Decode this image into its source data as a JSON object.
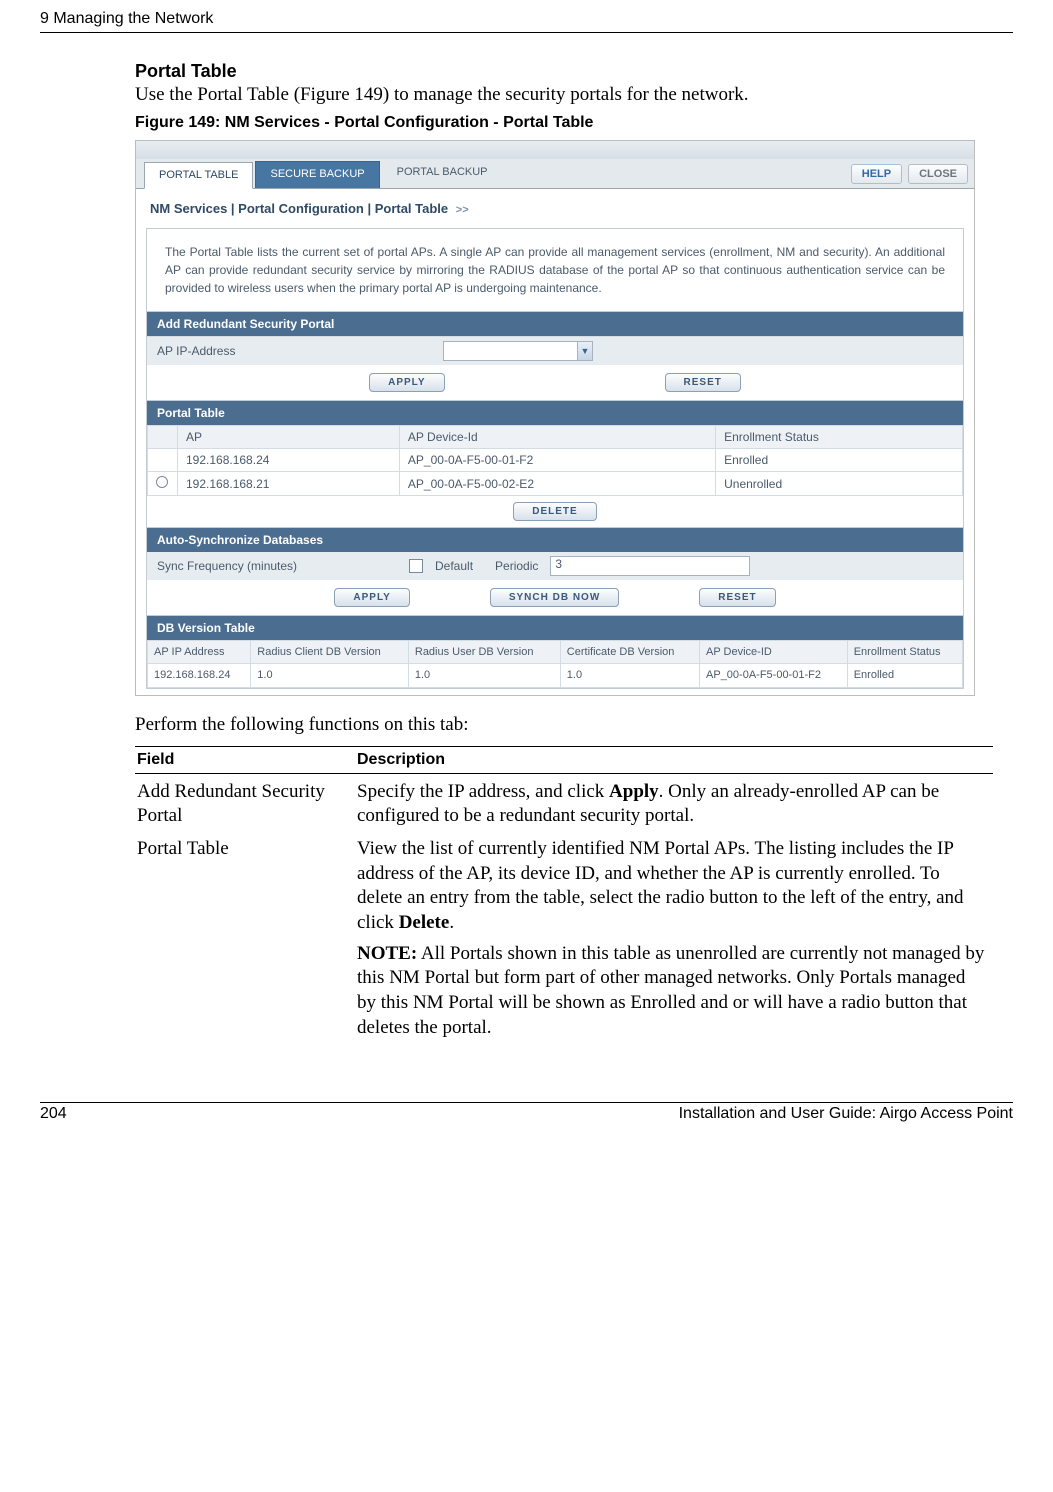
{
  "running_head": {
    "left": "9  Managing the Network",
    "right": ""
  },
  "section": {
    "subhead": "Portal Table",
    "intro": "Use the Portal Table (Figure 149) to manage the security portals for the network.",
    "figure_caption": "Figure 149:    NM Services - Portal Configuration - Portal Table"
  },
  "screenshot": {
    "tabs": {
      "portal_table": "PORTAL TABLE",
      "secure_backup": "SECURE BACKUP",
      "portal_backup": "PORTAL BACKUP"
    },
    "buttons": {
      "help": "HELP",
      "close": "CLOSE",
      "apply": "APPLY",
      "reset": "RESET",
      "delete": "DELETE",
      "synch": "SYNCH DB NOW"
    },
    "breadcrumb": "NM Services | Portal Configuration | Portal Table",
    "intro_text": "The Portal Table lists the current set of portal APs. A single AP can provide all management services (enrollment, NM and security). An additional AP can provide redundant security service by mirroring the RADIUS database of the portal AP so that continuous authentication service can be provided to wireless users when the primary portal AP is undergoing maintenance.",
    "add_portal": {
      "header": "Add Redundant Security Portal",
      "label": "AP IP-Address"
    },
    "portal_table": {
      "header": "Portal Table",
      "cols": {
        "ap": "AP",
        "device": "AP Device-Id",
        "status": "Enrollment Status"
      },
      "rows": [
        {
          "selectable": false,
          "ap": "192.168.168.24",
          "device": "AP_00-0A-F5-00-01-F2",
          "status": "Enrolled"
        },
        {
          "selectable": true,
          "ap": "192.168.168.21",
          "device": "AP_00-0A-F5-00-02-E2",
          "status": "Unenrolled"
        }
      ]
    },
    "sync": {
      "header": "Auto-Synchronize Databases",
      "label": "Sync Frequency (minutes)",
      "default": "Default",
      "periodic": "Periodic",
      "value": "3"
    },
    "db_table": {
      "header": "DB Version Table",
      "cols": {
        "ip": "AP\nIP Address",
        "rclient": "Radius\nClient\nDB Version",
        "ruser": "Radius\nUser\nDB Version",
        "cert": "Certificate\nDB Version",
        "device": "AP Device-ID",
        "status": "Enrollment\nStatus"
      },
      "rows": [
        {
          "ip": "192.168.168.24",
          "rclient": "1.0",
          "ruser": "1.0",
          "cert": "1.0",
          "device": "AP_00-0A-F5-00-01-F2",
          "status": "Enrolled"
        }
      ]
    }
  },
  "after_text": "Perform the following functions on this tab:",
  "table": {
    "head_field": "Field",
    "head_desc": "Description",
    "rows": [
      {
        "field": "Add Redundant Security Portal",
        "desc_before": "Specify the IP address, and click ",
        "desc_bold": "Apply",
        "desc_after": ". Only an already-enrolled AP can be configured to be a redundant security portal."
      },
      {
        "field": "Portal Table",
        "desc_before": "View the list of currently identified NM Portal APs. The listing includes the IP address of the AP, its device ID, and whether the AP is currently enrolled. To delete an entry from the table, select the radio button to the left of the entry, and click ",
        "desc_bold": "Delete",
        "desc_after": ".",
        "note_label": "NOTE:",
        "note_text": " All Portals shown in this table as unenrolled are currently not managed by this NM Portal but form part of other managed networks. Only Portals managed by this NM Portal will be shown as Enrolled and or will have a radio button that deletes the portal."
      }
    ]
  },
  "footer": {
    "page": "204",
    "title": "Installation and User Guide: Airgo Access Point"
  }
}
